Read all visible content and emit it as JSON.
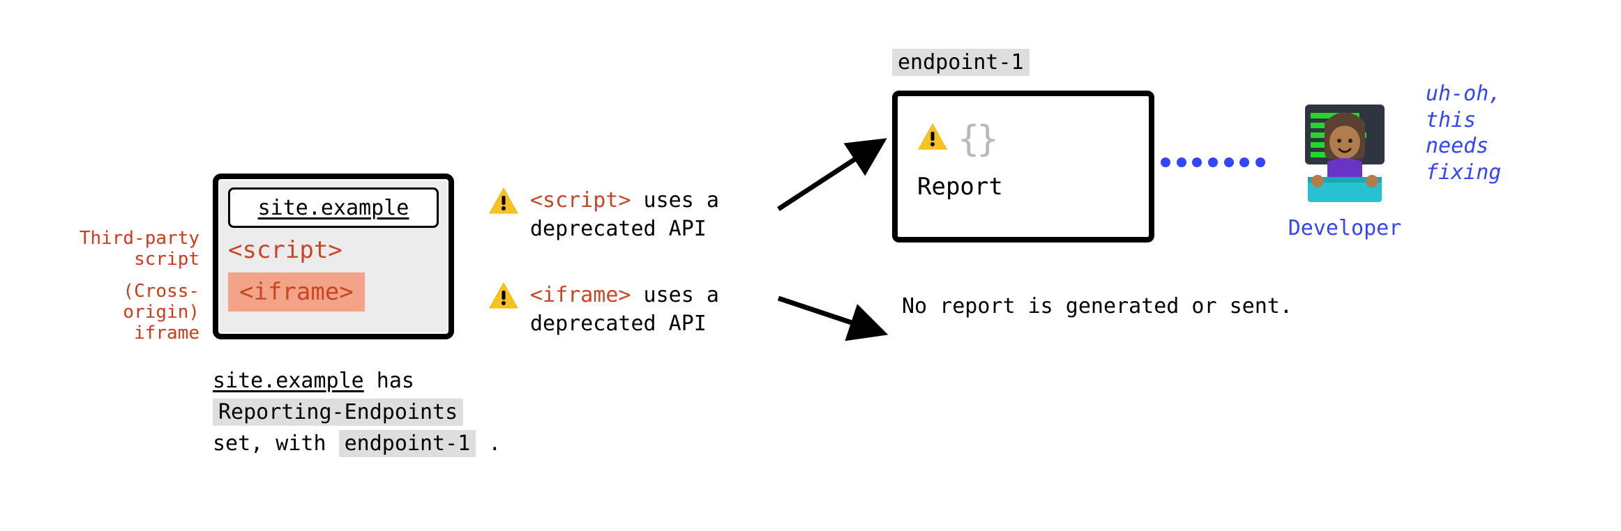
{
  "browser": {
    "url": "site.example",
    "script_tag": "<script>",
    "iframe_tag": "<iframe>"
  },
  "side_labels": {
    "script": "Third-party\nscript",
    "iframe": "(Cross-origin)\niframe"
  },
  "caption": {
    "l1_site": "site.example",
    "l1_rest": " has",
    "l2_hl": "Reporting-Endpoints",
    "l3_pre": "set, with ",
    "l3_hl": "endpoint-1",
    "l3_post": " ."
  },
  "warnings": {
    "script": {
      "code": "<script>",
      "rest": " uses a deprecated API"
    },
    "iframe": {
      "code": "<iframe>",
      "rest": " uses a deprecated API"
    }
  },
  "endpoint": {
    "name": "endpoint-1",
    "braces": "{}",
    "report_label": "Report"
  },
  "no_report": "No report is generated or sent.",
  "developer": {
    "label": "Developer",
    "quote": "uh-oh,\nthis\nneeds\nfixing"
  },
  "icons": {
    "warning": "warning-icon",
    "braces": "braces-icon",
    "arrow_up": "arrow-up-right-icon",
    "arrow_down": "arrow-down-right-icon",
    "developer": "developer-avatar-icon"
  }
}
